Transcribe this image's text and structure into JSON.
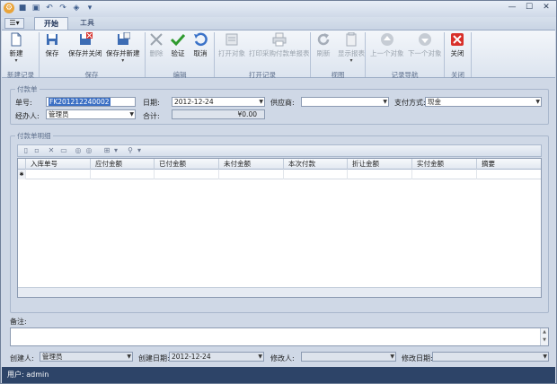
{
  "window": {
    "quick_access": [
      "⚙",
      "■",
      "▣",
      "↶",
      "↷",
      "◈",
      "▾"
    ],
    "controls": [
      "—",
      "☐",
      "✕"
    ]
  },
  "menu": {
    "label": "☰▾"
  },
  "tabs": [
    {
      "label": "开始"
    },
    {
      "label": "工具"
    }
  ],
  "ribbon": {
    "groups": [
      {
        "label": "新建记录"
      },
      {
        "label": "保存"
      },
      {
        "label": "编辑"
      },
      {
        "label": "打开记录"
      },
      {
        "label": "视图"
      },
      {
        "label": "记录导航"
      },
      {
        "label": "关闭"
      }
    ],
    "buttons": {
      "new": "新建",
      "save": "保存",
      "save_close": "保存并关闭",
      "save_new": "保存并新建",
      "delete": "删除",
      "validate": "验证",
      "cancel": "取消",
      "open_object": "打开对象",
      "print_report": "打印采购付款单报表",
      "refresh": "刷新",
      "view_report": "显示报表",
      "prev_object": "上一个对象",
      "next_object": "下一个对象",
      "close": "关闭"
    }
  },
  "header_section": {
    "title": "付款单",
    "doc_no_label": "单号:",
    "doc_no_value": "FK201212240002",
    "date_label": "日期:",
    "date_value": "2012-12-24",
    "supplier_label": "供应商:",
    "supplier_value": "",
    "pay_method_label": "支付方式:",
    "pay_method_value": "现金",
    "handler_label": "经办人:",
    "handler_value": "管理员",
    "total_label": "合计:",
    "total_value": "¥0.00"
  },
  "detail_section": {
    "title": "付款单明细",
    "toolbar_icons": [
      "▯",
      "▫",
      "✕",
      "▭",
      "◎",
      "◎",
      "⊞",
      "▾",
      "⚲",
      "▾"
    ],
    "columns": [
      "入库单号",
      "应付金额",
      "已付金额",
      "未付金额",
      "本次付款",
      "折让金额",
      "实付金额",
      "摘要"
    ],
    "rows": []
  },
  "memo": {
    "label": "备注:",
    "value": ""
  },
  "footer": {
    "creator_label": "创建人:",
    "creator_value": "管理员",
    "created_date_label": "创建日期:",
    "created_date_value": "2012-12-24",
    "modifier_label": "修改人:",
    "modifier_value": "",
    "modified_date_label": "修改日期:",
    "modified_date_value": ""
  },
  "status": {
    "text": "用户: admin"
  }
}
